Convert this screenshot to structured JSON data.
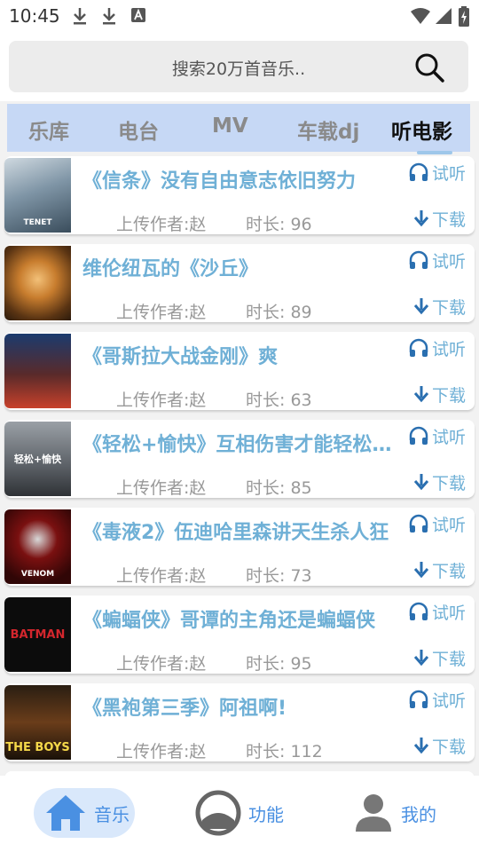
{
  "status_bar": {
    "time": "10:45",
    "left_icons": [
      "download-icon",
      "download-icon",
      "text-a-icon"
    ],
    "right_icons": [
      "wifi-icon",
      "signal-icon",
      "battery-charging-icon"
    ]
  },
  "search": {
    "placeholder": "搜索20万首音乐.."
  },
  "tabs": [
    {
      "label": "乐库",
      "active": false
    },
    {
      "label": "电台",
      "active": false
    },
    {
      "label": "MV",
      "active": false
    },
    {
      "label": "车载dj",
      "active": false
    },
    {
      "label": "听电影",
      "active": true
    }
  ],
  "list": {
    "listen_label": "试听",
    "download_label": "下载",
    "items": [
      {
        "title": "《信条》没有自由意志依旧努力",
        "author": "上传作者:赵",
        "duration": "时长: 96"
      },
      {
        "title": "维伦纽瓦的《沙丘》",
        "author": "上传作者:赵",
        "duration": "时长: 89"
      },
      {
        "title": "《哥斯拉大战金刚》爽",
        "author": "上传作者:赵",
        "duration": "时长: 63"
      },
      {
        "title": "《轻松+愉快》互相伤害才能轻松愉快",
        "author": "上传作者:赵",
        "duration": "时长: 85"
      },
      {
        "title": "《毒液2》伍迪哈里森讲天生杀人狂",
        "author": "上传作者:赵",
        "duration": "时长: 73"
      },
      {
        "title": "《蝙蝠侠》哥谭的主角还是蝙蝠侠",
        "author": "上传作者:赵",
        "duration": "时长: 95"
      },
      {
        "title": "《黑袍第三季》阿祖啊!",
        "author": "上传作者:赵",
        "duration": "时长: 112"
      }
    ]
  },
  "thumb_text": [
    "TENET",
    "",
    "",
    "轻松+愉快",
    "VENOM",
    "BATMAN",
    "THE BOYS"
  ],
  "bottom_nav": [
    {
      "label": "音乐",
      "icon": "home-icon",
      "active": true
    },
    {
      "label": "功能",
      "icon": "record-icon",
      "active": false
    },
    {
      "label": "我的",
      "icon": "user-icon",
      "active": false
    }
  ],
  "colors": {
    "accent": "#6fb0d6",
    "tab_bar": "#c6d8f5",
    "nav_active_bg": "#d9e8fb",
    "nav_icon_blue": "#4a90e2"
  }
}
